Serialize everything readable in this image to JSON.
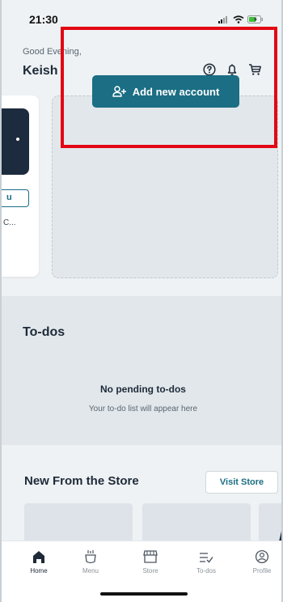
{
  "status_bar": {
    "time": "21:30"
  },
  "header": {
    "greeting": "Good Evening,",
    "user_name": "Keish"
  },
  "accounts": {
    "partial_card": {
      "button_text": "u",
      "text": "C..."
    },
    "add_button_label": "Add new account"
  },
  "todos": {
    "title": "To-dos",
    "empty_title": "No pending to-dos",
    "empty_subtitle": "Your to-do list will appear here"
  },
  "store": {
    "title": "New From the Store",
    "visit_label": "Visit Store"
  },
  "tabbar": {
    "tabs": [
      {
        "label": "Home",
        "icon": "home-icon",
        "active": true
      },
      {
        "label": "Menu",
        "icon": "menu-icon",
        "active": false
      },
      {
        "label": "Store",
        "icon": "store-icon",
        "active": false
      },
      {
        "label": "To-dos",
        "icon": "todos-icon",
        "active": false
      },
      {
        "label": "Profile",
        "icon": "profile-icon",
        "active": false
      }
    ]
  },
  "colors": {
    "accent": "#1b6e84",
    "highlight": "#e30613",
    "dark_card": "#1c2b3d",
    "battery": "#3cc13b"
  }
}
